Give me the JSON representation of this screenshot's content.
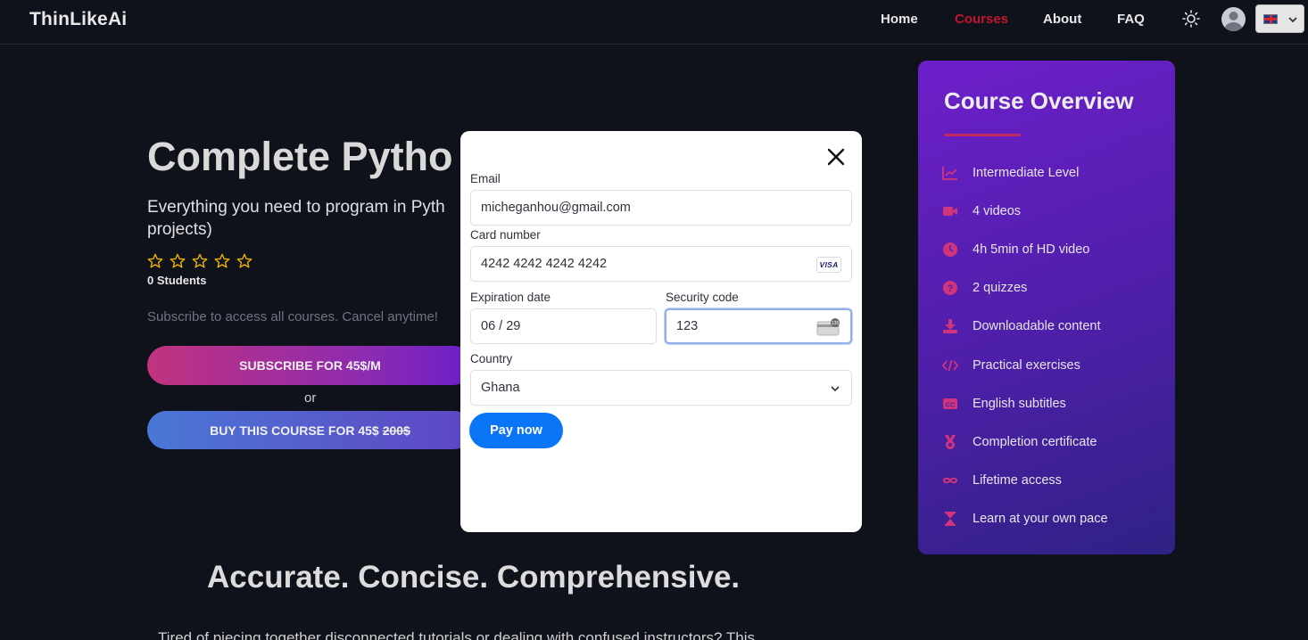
{
  "nav": {
    "brand": "ThinLikeAi",
    "links": [
      "Home",
      "Courses",
      "About",
      "FAQ"
    ],
    "active_link": "Courses"
  },
  "hero": {
    "title": "Complete Pytho",
    "subtitle": "Everything you need to program in Pyth projects)",
    "students": "0 Students",
    "subscribe_note": "Subscribe to access all courses. Cancel anytime!",
    "subscribe_button": "SUBSCRIBE FOR 45$/M",
    "or": "or",
    "buy_button": "BUY THIS COURSE FOR 45$",
    "buy_old_price": "200$"
  },
  "section": {
    "heading": "Accurate. Concise. Comprehensive.",
    "text": "Tired of piecing together disconnected tutorials or dealing with confused instructors? This"
  },
  "overview": {
    "title": "Course Overview",
    "items": [
      {
        "icon": "chart-line-icon",
        "label": "Intermediate Level"
      },
      {
        "icon": "video-camera-icon",
        "label": "4 videos"
      },
      {
        "icon": "clock-icon",
        "label": "4h 5min of HD video"
      },
      {
        "icon": "question-circle-icon",
        "label": "2 quizzes"
      },
      {
        "icon": "download-icon",
        "label": "Downloadable content"
      },
      {
        "icon": "code-icon",
        "label": "Practical exercises"
      },
      {
        "icon": "closed-captions-icon",
        "label": "English subtitles"
      },
      {
        "icon": "medal-icon",
        "label": "Completion certificate"
      },
      {
        "icon": "infinity-icon",
        "label": "Lifetime access"
      },
      {
        "icon": "hourglass-icon",
        "label": "Learn at your own pace"
      }
    ]
  },
  "payment": {
    "email_label": "Email",
    "email_value": "micheganhou@gmail.com",
    "card_label": "Card number",
    "card_value": "4242 4242 4242 4242",
    "card_brand": "VISA",
    "exp_label": "Expiration date",
    "exp_value": "06 / 29",
    "cvc_label": "Security code",
    "cvc_value": "123",
    "cvc_badge": "135",
    "country_label": "Country",
    "country_value": "Ghana",
    "pay_button": "Pay now"
  },
  "colors": {
    "accent": "#c3142e",
    "pay_button": "#0b76f5",
    "overview_start": "#6d1fc9",
    "overview_end": "#2f2184",
    "icon_pink": "#d0347a",
    "star": "#f0b400"
  }
}
